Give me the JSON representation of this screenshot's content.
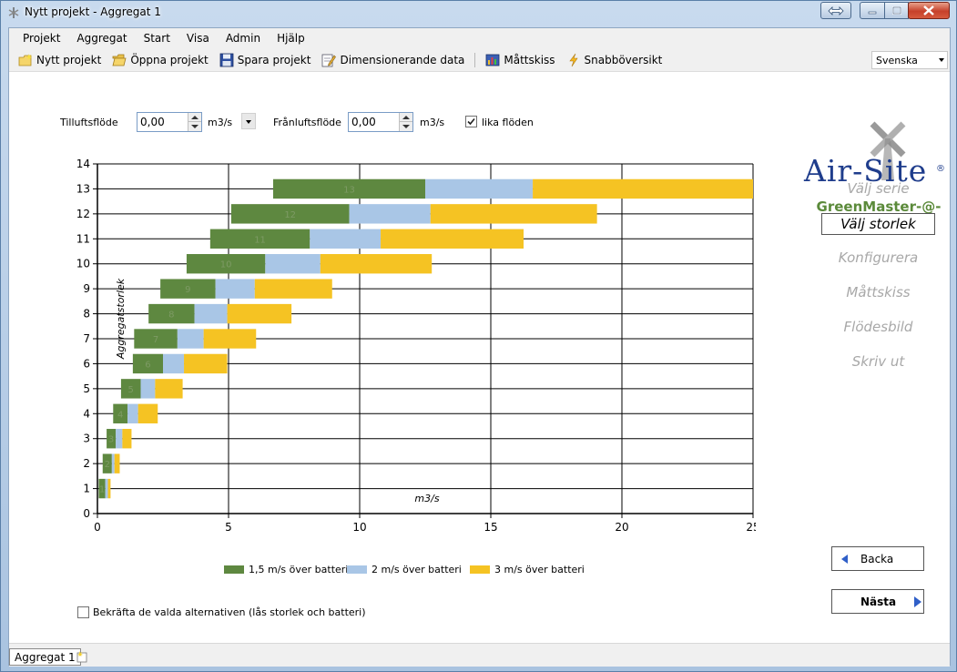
{
  "window": {
    "title": "Nytt projekt - Aggregat 1"
  },
  "menu": [
    "Projekt",
    "Aggregat",
    "Start",
    "Visa",
    "Admin",
    "Hjälp"
  ],
  "toolbar": {
    "new_project": "Nytt projekt",
    "open_project": "Öppna projekt",
    "save_project": "Spara projekt",
    "dimensioning": "Dimensionerande data",
    "dimension_sketch": "Måttskiss",
    "quick_overview": "Snabböversikt",
    "language": "Svenska"
  },
  "flow_inputs": {
    "supply_label": "Tilluftsflöde",
    "supply_value": "0,00",
    "supply_unit": "m3/s",
    "exhaust_label": "Frånluftsflöde",
    "exhaust_value": "0,00",
    "exhaust_unit": "m3/s",
    "equal_flows_label": "lika flöden",
    "equal_flows_checked": true
  },
  "chart_data": {
    "type": "bar",
    "orientation": "horizontal",
    "stacked": true,
    "xlabel": "m3/s",
    "ylabel": "Aggregatstorlek",
    "xlim": [
      0,
      25
    ],
    "ylim": [
      0,
      14
    ],
    "xticks": [
      0,
      5,
      10,
      15,
      20,
      25
    ],
    "yticks": [
      0,
      1,
      2,
      3,
      4,
      5,
      6,
      7,
      8,
      9,
      10,
      11,
      12,
      13,
      14
    ],
    "grid": true,
    "legend_position": "bottom",
    "categories": [
      1,
      2,
      3,
      4,
      5,
      6,
      7,
      8,
      9,
      10,
      11,
      12,
      13
    ],
    "series": [
      {
        "name": "1,5 m/s över batteri",
        "color": "#5e8840",
        "start": [
          0.05,
          0.2,
          0.35,
          0.6,
          0.9,
          1.35,
          1.4,
          1.95,
          2.4,
          3.4,
          4.3,
          5.1,
          6.7
        ],
        "end": [
          0.3,
          0.55,
          0.7,
          1.15,
          1.65,
          2.5,
          3.05,
          3.7,
          4.5,
          6.4,
          8.1,
          9.6,
          12.5
        ]
      },
      {
        "name": "2 m/s över batteri",
        "color": "#a9c6e6",
        "start": [
          0.3,
          0.55,
          0.7,
          1.15,
          1.65,
          2.5,
          3.05,
          3.7,
          4.5,
          6.4,
          8.1,
          9.6,
          12.5
        ],
        "end": [
          0.4,
          0.65,
          0.95,
          1.55,
          2.2,
          3.3,
          4.05,
          4.95,
          6.0,
          8.5,
          10.8,
          12.7,
          16.6
        ]
      },
      {
        "name": "3 m/s över batteri",
        "color": "#f5c323",
        "start": [
          0.4,
          0.65,
          0.95,
          1.55,
          2.2,
          3.3,
          4.05,
          4.95,
          6.0,
          8.5,
          10.8,
          12.7,
          16.6
        ],
        "end": [
          0.5,
          0.85,
          1.3,
          2.3,
          3.25,
          4.95,
          6.05,
          7.4,
          8.95,
          12.75,
          16.25,
          19.05,
          25
        ]
      }
    ]
  },
  "confirm": {
    "label": "Bekräfta de valda alternativen (lås storlek och batteri)",
    "checked": false
  },
  "sidebar": {
    "logo": "Air-Site",
    "registered": "®",
    "product": "GreenMaster-@-",
    "steps": [
      {
        "label": "Välj serie",
        "active": false
      },
      {
        "label": "Välj storlek",
        "active": true
      },
      {
        "label": "Konfigurera",
        "active": false
      },
      {
        "label": "Måttskiss",
        "active": false
      },
      {
        "label": "Flödesbild",
        "active": false
      },
      {
        "label": "Skriv ut",
        "active": false
      }
    ],
    "back_label": "Backa",
    "next_label": "Nästa"
  },
  "tabs": {
    "current": "Aggregat 1"
  }
}
